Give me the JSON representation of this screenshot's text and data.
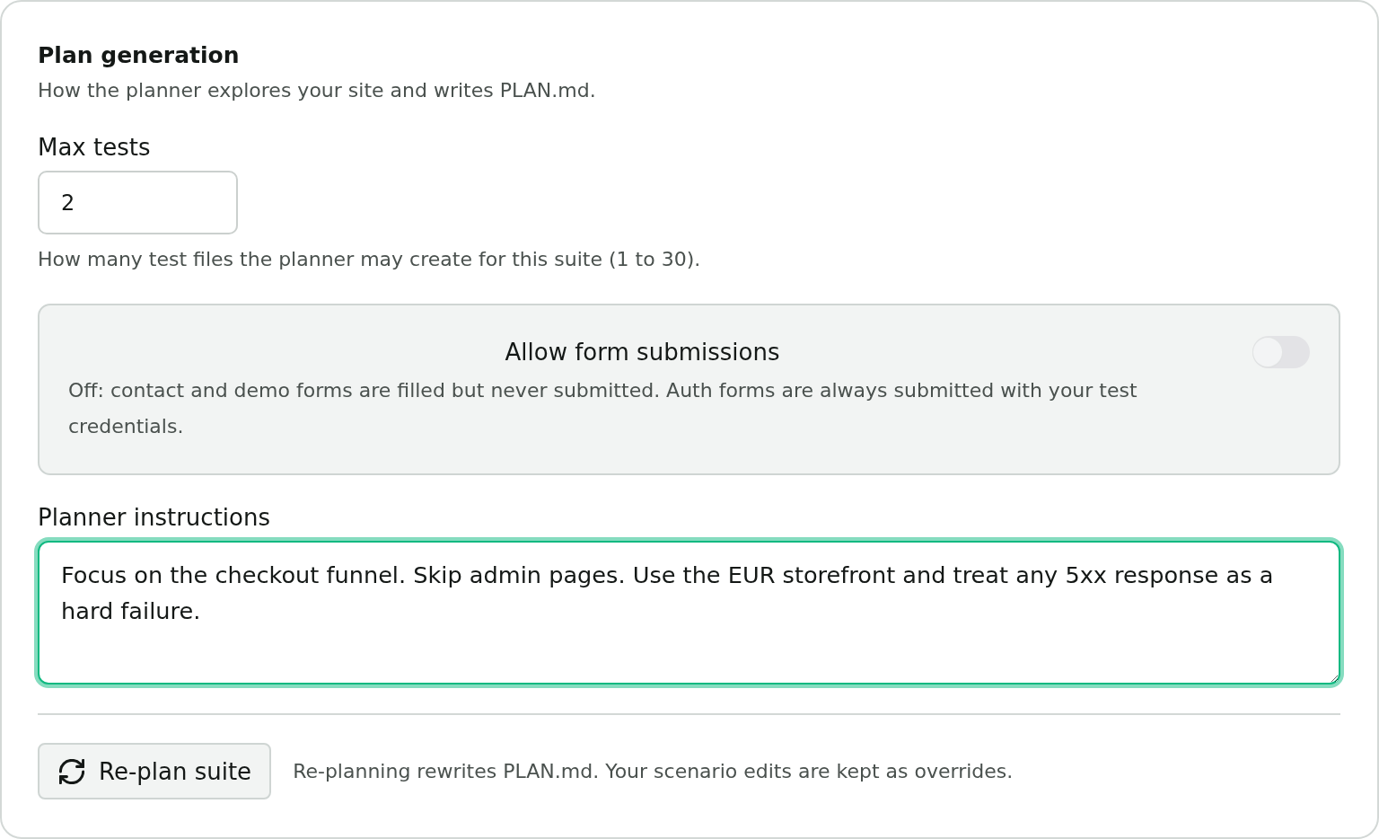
{
  "section": {
    "title": "Plan generation",
    "description": "How the planner explores your site and writes PLAN.md."
  },
  "max_tests": {
    "label": "Max tests",
    "value": "2",
    "help": "How many test files the planner may create for this suite (1 to 30)."
  },
  "form_submissions": {
    "title": "Allow form submissions",
    "description": "Off: contact and demo forms are filled but never submitted. Auth forms are always submitted with your test credentials.",
    "on": false
  },
  "planner_instructions": {
    "label": "Planner instructions",
    "value": "Focus on the checkout funnel. Skip admin pages. Use the EUR storefront and treat any 5xx response as a hard failure.",
    "focused": true
  },
  "replan": {
    "button": "Re-plan suite",
    "note": "Re-planning rewrites PLAN.md. Your scenario edits are kept as overrides."
  }
}
